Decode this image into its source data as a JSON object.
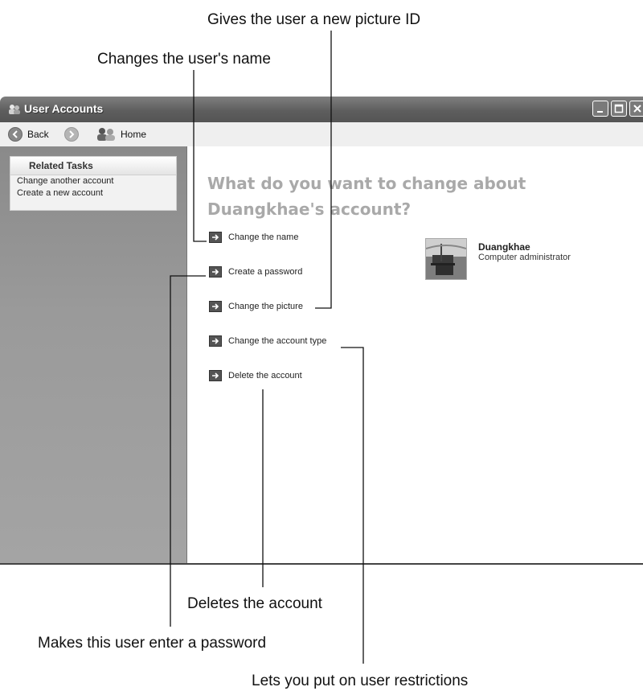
{
  "callouts": {
    "picture_id": "Gives the user a new picture ID",
    "change_name": "Changes the user's name",
    "delete_account": "Deletes the account",
    "password": "Makes this user enter a password",
    "restrictions": "Lets you put on user restrictions"
  },
  "window": {
    "title": "User Accounts",
    "title_icon": "user-accounts-icon"
  },
  "toolbar": {
    "back_label": "Back",
    "home_label": "Home"
  },
  "sidebar": {
    "panel_title": "Related Tasks",
    "links": [
      "Change another account",
      "Create a new account"
    ]
  },
  "main": {
    "heading": "What do you want to change about Duangkhae's account?",
    "actions": [
      "Change the name",
      "Create a password",
      "Change the picture",
      "Change the account type",
      "Delete the account"
    ]
  },
  "user": {
    "name": "Duangkhae",
    "type": "Computer administrator"
  }
}
